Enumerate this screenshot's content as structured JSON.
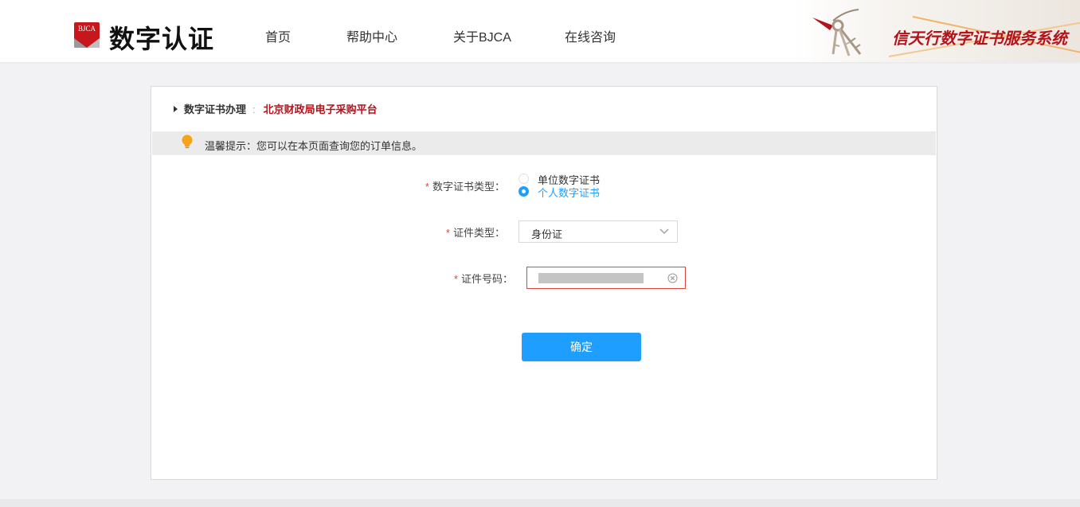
{
  "header": {
    "logo_text": "BJCA",
    "brand": "数字认证",
    "nav": [
      {
        "label": "首页"
      },
      {
        "label": "帮助中心"
      },
      {
        "label": "关于BJCA"
      },
      {
        "label": "在线咨询"
      }
    ],
    "system_title": "信天行数字证书服务系统",
    "accent_color": "#b5121b"
  },
  "breadcrumb": {
    "main": "数字证书办理",
    "separator": ":",
    "sub": "北京财政局电子采购平台"
  },
  "tip": {
    "text": "温馨提示：您可以在本页面查询您的订单信息。"
  },
  "form": {
    "required_mark": "*",
    "cert_type": {
      "label": "数字证书类型：",
      "options": [
        {
          "label": "单位数字证书",
          "checked": false
        },
        {
          "label": "个人数字证书",
          "checked": true
        }
      ]
    },
    "id_type": {
      "label": "证件类型：",
      "value": "身份证"
    },
    "id_number": {
      "label": "证件号码：",
      "value": ""
    },
    "submit_label": "确定",
    "primary_color": "#1e9fff",
    "error_color": "#e0463e"
  }
}
